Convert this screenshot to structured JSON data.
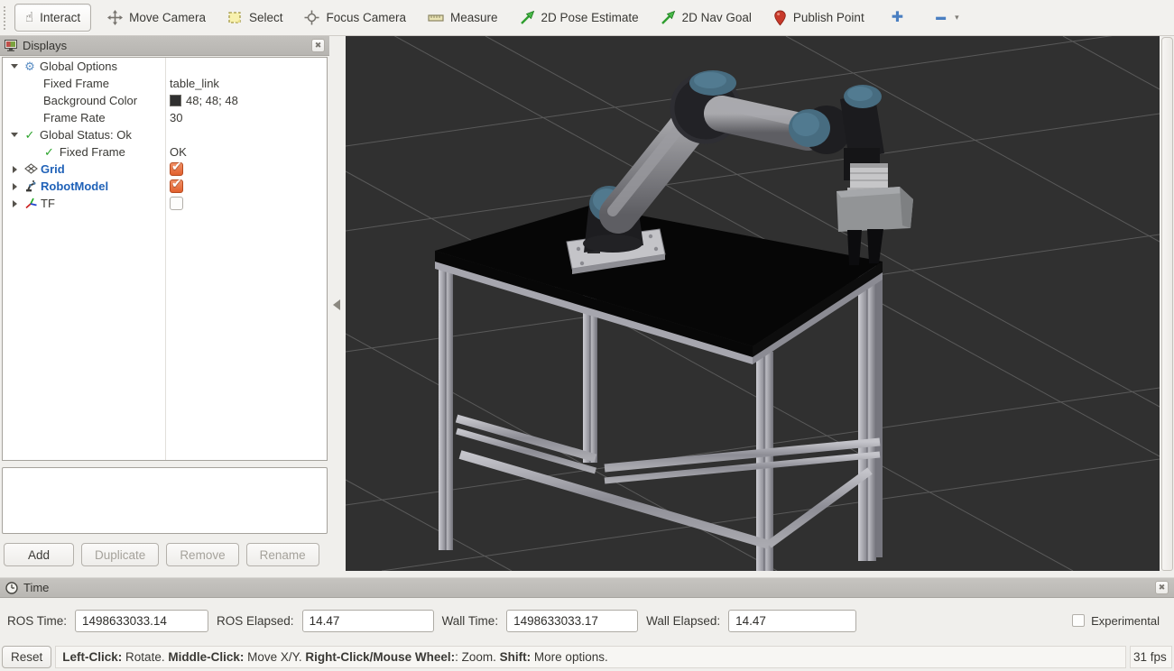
{
  "toolbar": {
    "tools": [
      {
        "label": "Interact"
      },
      {
        "label": "Move Camera"
      },
      {
        "label": "Select"
      },
      {
        "label": "Focus Camera"
      },
      {
        "label": "Measure"
      },
      {
        "label": "2D Pose Estimate"
      },
      {
        "label": "2D Nav Goal"
      },
      {
        "label": "Publish Point"
      }
    ]
  },
  "displays": {
    "title": "Displays",
    "tree": {
      "global_options": {
        "label": "Global Options"
      },
      "fixed_frame": {
        "label": "Fixed Frame",
        "value": "table_link"
      },
      "background_color": {
        "label": "Background Color",
        "value": "48; 48; 48",
        "swatch": "#303030"
      },
      "frame_rate": {
        "label": "Frame Rate",
        "value": "30"
      },
      "global_status": {
        "label": "Global Status: Ok"
      },
      "status_fixed_frame": {
        "label": "Fixed Frame",
        "value": "OK"
      },
      "grid": {
        "label": "Grid",
        "checked": true
      },
      "robot_model": {
        "label": "RobotModel",
        "checked": true
      },
      "tf": {
        "label": "TF",
        "checked": false
      }
    },
    "buttons": {
      "add": "Add",
      "duplicate": "Duplicate",
      "remove": "Remove",
      "rename": "Rename"
    }
  },
  "time_panel": {
    "title": "Time",
    "fields": [
      {
        "label": "ROS Time:",
        "value": "1498633033.14"
      },
      {
        "label": "ROS Elapsed:",
        "value": "14.47"
      },
      {
        "label": "Wall Time:",
        "value": "1498633033.17"
      },
      {
        "label": "Wall Elapsed:",
        "value": "14.47"
      }
    ],
    "experimental_label": "Experimental",
    "experimental_checked": false
  },
  "status_bar": {
    "reset_label": "Reset",
    "help_parts": [
      {
        "text": "Left-Click:"
      },
      {
        "text": " Rotate. "
      },
      {
        "text": "Middle-Click:"
      },
      {
        "text": " Move X/Y. "
      },
      {
        "text": "Right-Click/Mouse Wheel:"
      },
      {
        "text": ": Zoom. "
      },
      {
        "text": "Shift:"
      },
      {
        "text": " More options."
      }
    ],
    "fps": "31 fps"
  },
  "viewport": {
    "background_color": "#303030",
    "grid_line_color": "#5a5a5a"
  }
}
